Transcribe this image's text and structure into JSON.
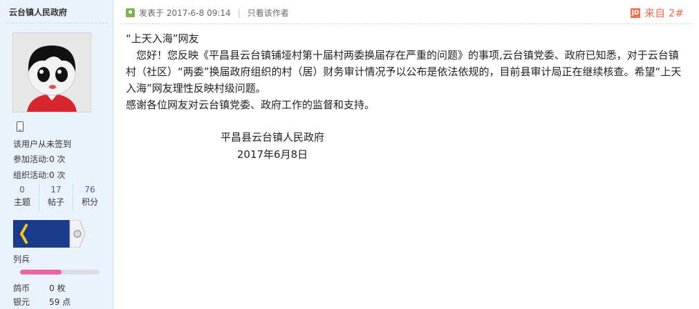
{
  "user": {
    "name": "云台镇人民政府",
    "sign_status": "该用户从未签到",
    "activities_join": {
      "label": "参加活动:",
      "value": "0 次"
    },
    "activities_org": {
      "label": "组织活动:",
      "value": "0 次"
    },
    "counts": [
      {
        "value": "0",
        "label": "主题"
      },
      {
        "value": "17",
        "label": "帖子"
      },
      {
        "value": "76",
        "label": "积分"
      }
    ],
    "rank": "列兵",
    "rank_progress": 0.52,
    "coins": {
      "label": "鸽币",
      "value": "0 枚"
    },
    "silver": {
      "label": "银元",
      "value": "59 点"
    }
  },
  "post": {
    "posted_label": "发表于 2017-6-8 09:14",
    "author_only": "只看该作者",
    "floor": "来自 2#",
    "floor_icon_text": "JD",
    "greeting": "“上天入海”网友",
    "body": "　您好！您反映《平昌县云台镇铺垭村第十届村两委换届存在严重的问题》的事项,云台镇党委、政府已知悉，对于云台镇村（社区）“两委”换届政府组织的村（居）财务审计情况予以公布是依法依规的，目前县审计局正在继续核查。希望“上天入海”网友理性反映村级问题。",
    "thanks": "感谢各位网友对云台镇党委、政府工作的监督和支持。",
    "signature_org": "平昌县云台镇人民政府",
    "signature_date": "2017年6月8日"
  }
}
